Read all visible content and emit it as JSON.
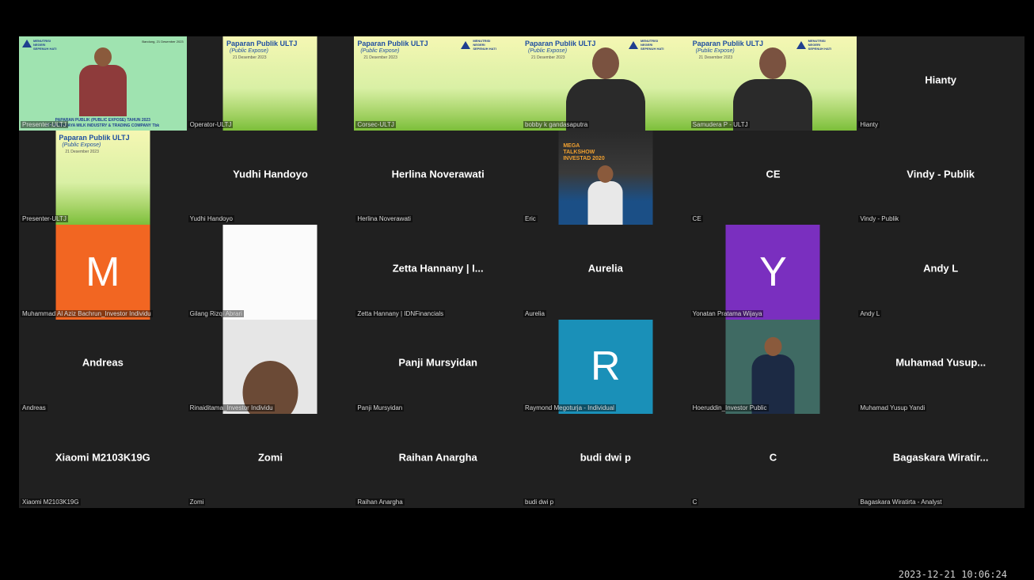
{
  "tiles": [
    {
      "name": "Presenter-ULTJ",
      "display": "",
      "label": "Presenter-ULTJ",
      "type": "stage",
      "slide": {
        "top_date": "Bandung, 21 Desember 2023",
        "banner_line1": "PAPARAN PUBLIK (PUBLIC EXPOSE) TAHUN 2023",
        "banner_line2": "PT ULTRAJAYA MILK INDUSTRY & TRADING COMPANY Tbk",
        "logo_text": "MENUTRISI NEGERI SEPENUH HATI"
      }
    },
    {
      "name": "Operator-ULTJ",
      "display": "",
      "label": "Operator-ULTJ",
      "type": "slide",
      "slide": {
        "title": "Paparan Publik ULTJ",
        "subtitle": "(Public Expose)",
        "date": "21 Desember 2023"
      }
    },
    {
      "name": "Corsec-ULTJ",
      "display": "",
      "label": "Corsec-ULTJ",
      "type": "slide",
      "slide": {
        "title": "Paparan Publik ULTJ",
        "subtitle": "(Public Expose)",
        "date": "21 Desember 2023",
        "logo_text": "MENUTRISI NEGERI SEPENUH HATI"
      }
    },
    {
      "name": "Bobby",
      "display": "",
      "label": "bobby k gandasaputra",
      "type": "slide-person",
      "slide": {
        "title": "Paparan Publik ULTJ",
        "subtitle": "(Public Expose)",
        "date": "21 Desember 2023",
        "logo_text": "MENUTRISI NEGERI SEPENUH HATI"
      }
    },
    {
      "name": "Samudera",
      "display": "",
      "label": "Samudera P - ULTJ",
      "type": "slide-person",
      "slide": {
        "title": "Paparan Publik ULTJ",
        "subtitle": "(Public Expose)",
        "date": "21 Desember 2023",
        "logo_text": "MENUTRISI NEGERI SEPENUH HATI"
      }
    },
    {
      "name": "Hianty",
      "display": "Hianty",
      "label": "Hianty",
      "type": "name"
    },
    {
      "name": "Presenter2",
      "display": "",
      "label": "Presenter-ULTJ",
      "type": "slide",
      "slide": {
        "title": "Paparan Publik ULTJ",
        "subtitle": "(Public Expose)",
        "date": "21 Desember 2023"
      }
    },
    {
      "name": "Yudhi",
      "display": "Yudhi Handoyo",
      "label": "Yudhi Handoyo",
      "type": "name"
    },
    {
      "name": "Herlina",
      "display": "Herlina Noverawati",
      "label": "Herlina Noverawati",
      "type": "name"
    },
    {
      "name": "Eric",
      "display": "",
      "label": "Eric",
      "type": "video",
      "banner": "MEGA TALKSHOW INVESTAD 2020"
    },
    {
      "name": "CE",
      "display": "CE",
      "label": "CE",
      "type": "name"
    },
    {
      "name": "Vindy",
      "display": "Vindy - Publik",
      "label": "Vindy - Publik",
      "type": "name"
    },
    {
      "name": "Muhammad",
      "display": "",
      "label": "Muhammad Al Aziz Bachrun_Investor Individu",
      "type": "letter",
      "letter": "M",
      "color": "#f26622"
    },
    {
      "name": "Gilang",
      "display": "",
      "label": "Gilang Rizqi Abrari",
      "type": "blank"
    },
    {
      "name": "Zetta",
      "display": "Zetta Hannany | I...",
      "label": "Zetta Hannany | IDNFinancials",
      "type": "name"
    },
    {
      "name": "Aurelia",
      "display": "Aurelia",
      "label": "Aurelia",
      "type": "name"
    },
    {
      "name": "Yonatan",
      "display": "",
      "label": "Yonatan Pratama Wijaya",
      "type": "letter",
      "letter": "Y",
      "color": "#7a2fbf"
    },
    {
      "name": "AndyL",
      "display": "Andy L",
      "label": "Andy L",
      "type": "name"
    },
    {
      "name": "Andreas",
      "display": "Andreas",
      "label": "Andreas",
      "type": "name"
    },
    {
      "name": "Rinaiditama",
      "display": "",
      "label": "Rinaiditama_Investor Individu",
      "type": "face"
    },
    {
      "name": "Panji",
      "display": "Panji Mursyidan",
      "label": "Panji Mursyidan",
      "type": "name"
    },
    {
      "name": "Raymond",
      "display": "",
      "label": "Raymond Megoturja - Individual",
      "type": "letter",
      "letter": "R",
      "color": "#1a90b8"
    },
    {
      "name": "Hoeruddin",
      "display": "",
      "label": "Hoeruddin_Investor Public",
      "type": "speaker"
    },
    {
      "name": "Muhamad",
      "display": "Muhamad Yusup...",
      "label": "Muhamad Yusup Yandi",
      "type": "name"
    },
    {
      "name": "Xiaomi",
      "display": "Xiaomi M2103K19G",
      "label": "Xiaomi M2103K19G",
      "type": "name"
    },
    {
      "name": "Zomi",
      "display": "Zomi",
      "label": "Zomi",
      "type": "name"
    },
    {
      "name": "Raihan",
      "display": "Raihan Anargha",
      "label": "Raihan Anargha",
      "type": "name"
    },
    {
      "name": "Budi",
      "display": "budi dwi p",
      "label": "budi dwi p",
      "type": "name"
    },
    {
      "name": "C",
      "display": "C",
      "label": "C",
      "type": "name"
    },
    {
      "name": "Bagaskara",
      "display": "Bagaskara Wiratir...",
      "label": "Bagaskara Wiratirta - Analyst",
      "type": "name"
    }
  ],
  "timestamp": "2023-12-21  10:06:24"
}
